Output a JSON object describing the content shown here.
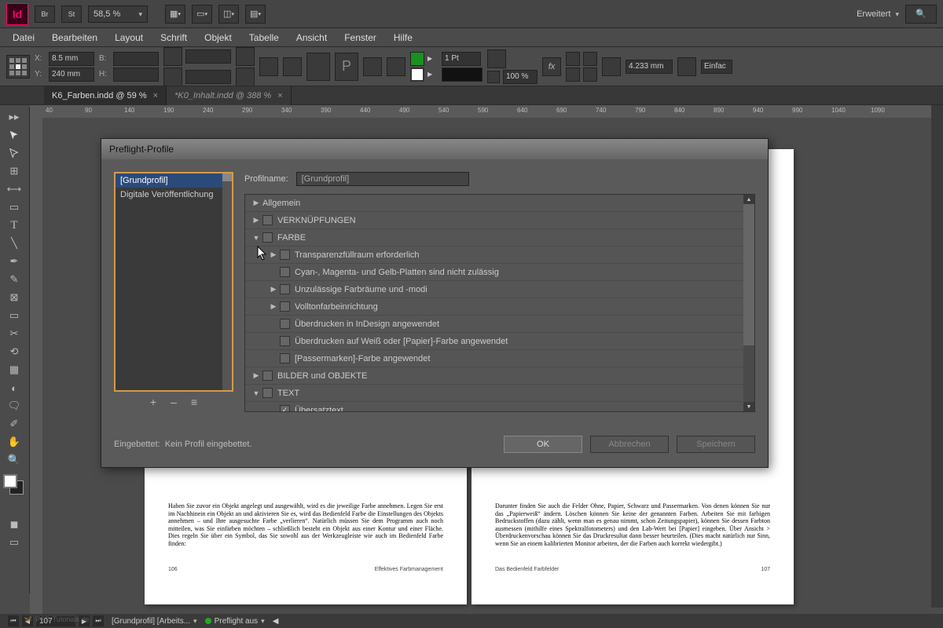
{
  "app": {
    "logo": "Id",
    "br": "Br",
    "st": "St",
    "zoom": "58,5 %",
    "workspace": "Erweitert"
  },
  "menu": {
    "items": [
      "Datei",
      "Bearbeiten",
      "Layout",
      "Schrift",
      "Objekt",
      "Tabelle",
      "Ansicht",
      "Fenster",
      "Hilfe"
    ]
  },
  "ctrl": {
    "x_label": "X:",
    "x": "8.5 mm",
    "y_label": "Y:",
    "y": "240 mm",
    "w_label": "B:",
    "h_label": "H:",
    "stroke": "1 Pt",
    "opacity": "100 %",
    "measure": "4.233 mm",
    "extras": "Einfac"
  },
  "tabs": [
    {
      "name": "K6_Farben.indd @ 59 %",
      "active": true
    },
    {
      "name": "*K0_Inhalt.indd @ 388 %",
      "active": false
    }
  ],
  "ruler_marks": [
    40,
    90,
    140,
    190,
    240,
    290,
    340,
    390,
    440,
    490,
    540,
    590,
    640,
    690,
    740,
    790,
    840,
    890,
    940,
    990,
    1040,
    1090
  ],
  "document": {
    "left_text": "Haben Sie zuvor ein Objekt angelegt und ausgewählt, wird es die jeweilige Farbe annehmen. Legen Sie erst im Nachhinein ein Objekt an und aktivieren Sie es, wird das Bedienfeld Farbe die Einstellungen des Objekts annehmen – und Ihre ausgesuchte Farbe „verlieren“.\n\nNatürlich müssen Sie dem Programm auch noch mitteilen, was Sie einfärben möchten – schließlich besteht ein Objekt aus einer Kontur und einer Fläche. Dies regeln Sie über ein Symbol, das Sie sowohl aus der Werkzeugleiste wie auch im Bedienfeld Farbe finden:",
    "left_folio_num": "106",
    "left_folio_title": "Effektives Farbmanagement",
    "right_text": "Darunter finden Sie auch die Felder Ohne, Papier, Schwarz und Passermarken. Von denen können Sie nur das „Papierweiß“ ändern. Löschen können Sie keine der genannten Farben. Arbeiten Sie mit farbigen Bedruckstoffen (dazu zählt, wenn man es genau nimmt, schon Zeitungspapier), können Sie dessen Farbton ausmessen (mithilfe eines Spektralfotometers) und den Lab-Wert bei [Papier] eingeben. Über Ansicht > Überdruckenvorschau können Sie das Druckresultat dann besser beurteilen. (Dies macht natürlich nur Sinn, wenn Sie an einem kalibrierten Monitor arbeiten, der die Farben auch korrekt wiedergibt.)",
    "right_folio_title": "Das Bedienfeld Farbfelder",
    "right_folio_num": "107"
  },
  "statusbar": {
    "page": "107",
    "profile": "[Grundprofil] [Arbeits...",
    "preflight": "Preflight aus"
  },
  "dialog": {
    "title": "Preflight-Profile",
    "profiles": [
      "[Grundprofil]",
      "Digitale Veröffentlichung"
    ],
    "name_label": "Profilname:",
    "name_value": "[Grundprofil]",
    "tree": [
      {
        "indent": 0,
        "arrow": "▶",
        "chk": null,
        "label": "Allgemein"
      },
      {
        "indent": 0,
        "arrow": "▶",
        "chk": "",
        "label": "VERKNÜPFUNGEN"
      },
      {
        "indent": 0,
        "arrow": "▼",
        "chk": "",
        "label": "FARBE"
      },
      {
        "indent": 1,
        "arrow": "▶",
        "chk": "",
        "label": "Transparenzfüllraum erforderlich"
      },
      {
        "indent": 1,
        "arrow": "",
        "chk": "",
        "label": "Cyan-, Magenta- und Gelb-Platten sind nicht zulässig"
      },
      {
        "indent": 1,
        "arrow": "▶",
        "chk": "",
        "label": "Unzulässige Farbräume und -modi"
      },
      {
        "indent": 1,
        "arrow": "▶",
        "chk": "",
        "label": "Volltonfarbeinrichtung"
      },
      {
        "indent": 1,
        "arrow": "",
        "chk": "",
        "label": "Überdrucken in InDesign angewendet"
      },
      {
        "indent": 1,
        "arrow": "",
        "chk": "",
        "label": "Überdrucken auf Weiß oder [Papier]-Farbe angewendet"
      },
      {
        "indent": 1,
        "arrow": "",
        "chk": "",
        "label": "[Passermarken]-Farbe angewendet"
      },
      {
        "indent": 0,
        "arrow": "▶",
        "chk": "",
        "label": "BILDER und OBJEKTE"
      },
      {
        "indent": 0,
        "arrow": "▼",
        "chk": "",
        "label": "TEXT"
      },
      {
        "indent": 1,
        "arrow": "",
        "chk": "✓",
        "label": "Übersatztext"
      }
    ],
    "list_add": "+",
    "list_del": "–",
    "list_menu": "≡",
    "embed_label": "Eingebettet:",
    "embed_status": "Kein Profil eingebettet.",
    "ok": "OK",
    "cancel": "Abbrechen",
    "save": "Speichern"
  },
  "watermark": "PSD-Tutorials.de"
}
